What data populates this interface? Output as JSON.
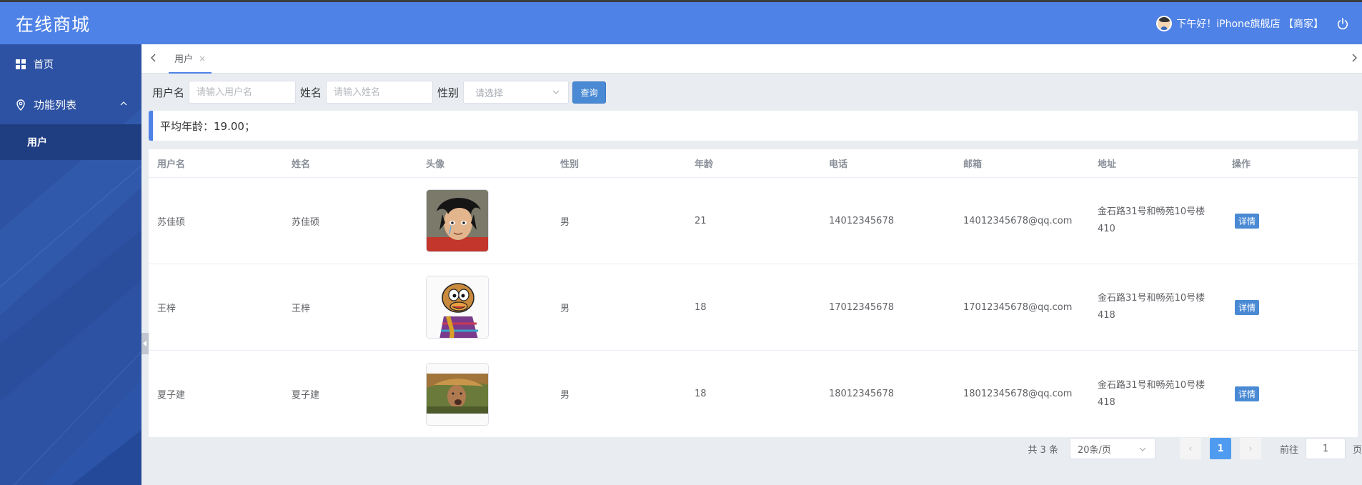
{
  "app": {
    "title": "在线商城"
  },
  "header": {
    "greeting": "下午好！iPhone旗舰店 【商家】"
  },
  "sidebar": {
    "items": [
      {
        "label": "首页",
        "icon": "grid-icon"
      },
      {
        "label": "功能列表",
        "icon": "location-icon"
      }
    ],
    "subitems": [
      {
        "label": "用户"
      }
    ]
  },
  "tabs": [
    {
      "label": "用户",
      "close": "×"
    }
  ],
  "search": {
    "username_label": "用户名",
    "username_placeholder": "请输入用户名",
    "name_label": "姓名",
    "name_placeholder": "请输入姓名",
    "gender_label": "性别",
    "gender_placeholder": "请选择",
    "query_button": "查询"
  },
  "summary": {
    "text": "平均年龄：19.00；"
  },
  "table": {
    "headers": [
      "用户名",
      "姓名",
      "头像",
      "性别",
      "年龄",
      "电话",
      "邮箱",
      "地址",
      "操作"
    ],
    "rows": [
      {
        "username": "苏佳硕",
        "name": "苏佳硕",
        "avatar": "anime-avatar-1",
        "gender": "男",
        "age": "21",
        "phone": "14012345678",
        "email": "14012345678@qq.com",
        "address": "金石路31号和畅苑10号楼410",
        "action": "详情"
      },
      {
        "username": "王梓",
        "name": "王梓",
        "avatar": "cartoon-avatar-2",
        "gender": "男",
        "age": "18",
        "phone": "17012345678",
        "email": "17012345678@qq.com",
        "address": "金石路31号和畅苑10号楼418",
        "action": "详情"
      },
      {
        "username": "夏子建",
        "name": "夏子建",
        "avatar": "photo-avatar-3",
        "gender": "男",
        "age": "18",
        "phone": "18012345678",
        "email": "18012345678@qq.com",
        "address": "金石路31号和畅苑10号楼418",
        "action": "详情"
      }
    ]
  },
  "pagination": {
    "total": "共 3 条",
    "page_size": "20条/页",
    "current_page": "1",
    "prev": "‹",
    "next": "›",
    "goto_label": "前往",
    "goto_value": "1",
    "page_suffix": "页"
  },
  "colors": {
    "header": "#4f82e6",
    "sidebar": "#2d52a3",
    "accent": "#4a8ad4"
  }
}
